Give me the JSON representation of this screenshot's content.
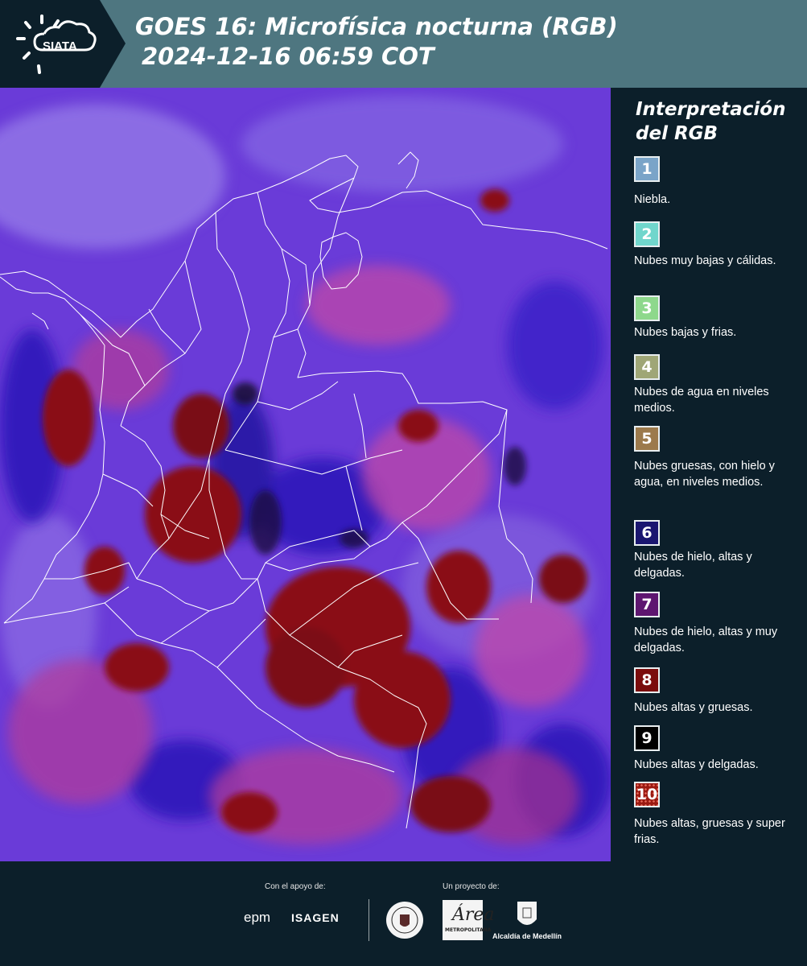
{
  "header": {
    "brand": "SIATA",
    "title_line1": "GOES 16: Microfísica nocturna (RGB)",
    "title_line2": "2024-12-16 06:59 COT"
  },
  "legend": {
    "title": "Interpretación del RGB",
    "items": [
      {
        "num": "1",
        "color": "#7aa4c8",
        "desc": "Niebla."
      },
      {
        "num": "2",
        "color": "#70d6cc",
        "desc": "Nubes muy bajas y cálidas."
      },
      {
        "num": "3",
        "color": "#8ed88c",
        "desc": "Nubes bajas y frias."
      },
      {
        "num": "4",
        "color": "#9fa676",
        "desc": "Nubes de agua en niveles medios."
      },
      {
        "num": "5",
        "color": "#9c7a4c",
        "desc": "Nubes gruesas, con hielo y agua, en niveles medios."
      },
      {
        "num": "6",
        "color": "#1a1670",
        "desc": "Nubes de hielo, altas y delgadas."
      },
      {
        "num": "7",
        "color": "#5e1670",
        "desc": "Nubes de hielo, altas y muy delgadas."
      },
      {
        "num": "8",
        "color": "#7a0c0c",
        "desc": "Nubes altas y gruesas."
      },
      {
        "num": "9",
        "color": "#000000",
        "desc": "Nubes altas y delgadas."
      },
      {
        "num": "10",
        "color": "#9a1a12",
        "desc": "Nubes altas, gruesas y super frias."
      }
    ]
  },
  "footer": {
    "support_label": "Con el apoyo de:",
    "project_label": "Un proyecto de:",
    "sponsor_epm": "epm",
    "sponsor_isagen": "ISAGEN",
    "area_letter": "Área",
    "area_subtitle": "METROPOLITANA",
    "medellin": "Alcaldía de Medellín"
  },
  "colors": {
    "header_bg": "#4e7680",
    "page_bg": "#0c1f2a",
    "map_base": "#6a3bd8"
  }
}
